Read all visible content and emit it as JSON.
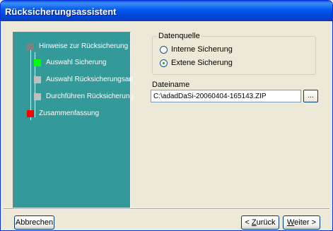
{
  "window": {
    "title": "Rücksicherungsassistent"
  },
  "steps": [
    {
      "label": "Hinweise zur Rücksicherung",
      "color": "#808080"
    },
    {
      "label": "Auswahl Sicherung",
      "color": "#00ff00"
    },
    {
      "label": "Auswahl Rücksicherungsart",
      "color": "#c0c0c0"
    },
    {
      "label": "Durchführen Rücksicherung",
      "color": "#c0c0c0"
    },
    {
      "label": "Zusammenfassung",
      "color": "#ff0000"
    }
  ],
  "source_group": {
    "legend": "Datenquelle",
    "options": [
      {
        "label": "Interne Sicherung",
        "selected": false
      },
      {
        "label": "Extene Sicherung",
        "selected": true
      }
    ]
  },
  "file": {
    "label": "Dateiname",
    "value": "C:\\adadDaSi-20060404-165143.ZIP",
    "browse_label": "..."
  },
  "buttons": {
    "cancel": "Abbrechen",
    "back_mnemonic": "Z",
    "back_rest": "urück",
    "back_prefix": "< ",
    "next_mnemonic": "W",
    "next_rest": "eiter >"
  }
}
